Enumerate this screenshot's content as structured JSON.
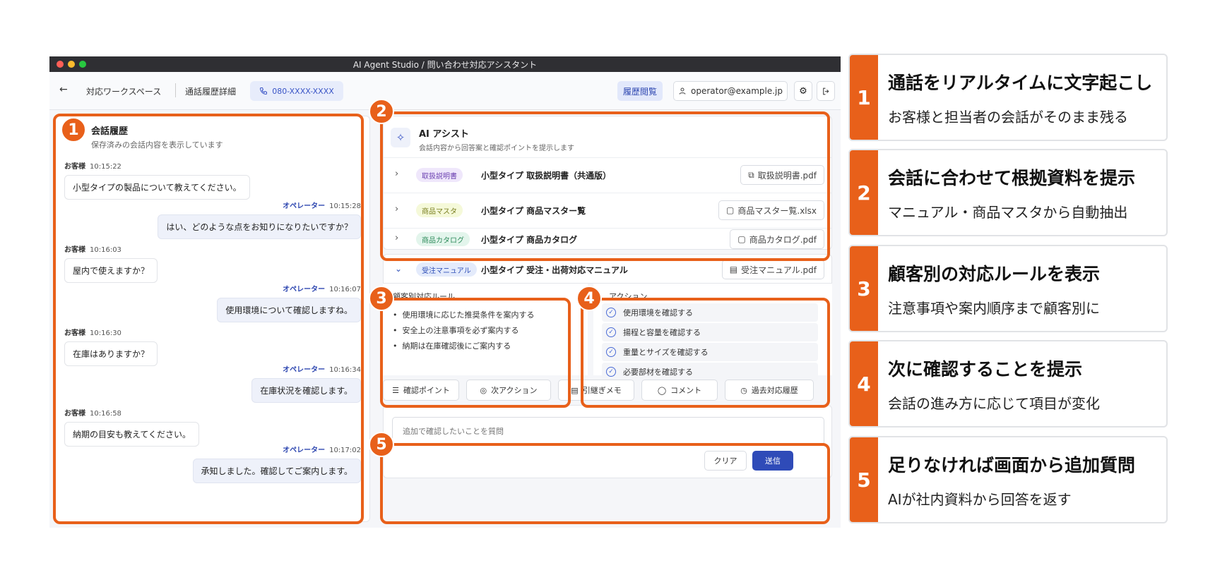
{
  "window": {
    "title": "AI Agent Studio / 問い合わせ対応アシスタント"
  },
  "header": {
    "back_icon": "←",
    "breadcrumb1": "対応ワークスペース",
    "breadcrumb2": "通話履歴詳細",
    "phone": "080-XXXX-XXXX",
    "history_button": "履歴閲覧",
    "user": "operator@example.jp"
  },
  "chat": {
    "title": "会話履歴",
    "subtitle": "保存済みの会話内容を表示しています",
    "messages": [
      {
        "who": "お客様",
        "time": "10:15:22",
        "text": "小型タイプの製品について教えてください。"
      },
      {
        "who": "オペレーター",
        "time": "10:15:28",
        "text": "はい、どのような点をお知りになりたいですか？"
      },
      {
        "who": "お客様",
        "time": "10:16:03",
        "text": "屋内で使えますか？"
      },
      {
        "who": "オペレーター",
        "time": "10:16:07",
        "text": "使用環境について確認しますね。"
      },
      {
        "who": "お客様",
        "time": "10:16:30",
        "text": "在庫はありますか？"
      },
      {
        "who": "オペレーター",
        "time": "10:16:34",
        "text": "在庫状況を確認します。"
      },
      {
        "who": "お客様",
        "time": "10:16:58",
        "text": "納期の目安も教えてください。"
      },
      {
        "who": "オペレーター",
        "time": "10:17:02",
        "text": "承知しました。確認してご案内します。"
      }
    ]
  },
  "assist": {
    "title": "AI アシスト",
    "subtitle": "会話内容から回答案と確認ポイントを提示します",
    "docs": [
      {
        "tag": "取扱説明書",
        "name": "小型タイプ 取扱説明書（共通版）",
        "file": "取扱説明書.pdf"
      },
      {
        "tag": "商品マスタ",
        "name": "小型タイプ 商品マスター覧",
        "file": "商品マスター覧.xlsx"
      },
      {
        "tag": "商品カタログ",
        "name": "小型タイプ 商品カタログ",
        "file": "商品カタログ.pdf"
      },
      {
        "tag": "受注マニュアル",
        "name": "小型タイプ 受注・出荷対応マニュアル",
        "file": "受注マニュアル.pdf"
      }
    ]
  },
  "rules": {
    "title": "顧客別対応ルール",
    "items": [
      "使用環境に応じた推奨条件を案内する",
      "安全上の注意事項を必ず案内する",
      "納期は在庫確認後にご案内する"
    ]
  },
  "actions": {
    "title": "アクション",
    "items": [
      "使用環境を確認する",
      "揚程と容量を確認する",
      "重量とサイズを確認する",
      "必要部材を確認する"
    ]
  },
  "tabs": [
    "確認ポイント",
    "次アクション",
    "引継ぎメモ",
    "コメント",
    "過去対応履歴"
  ],
  "ask": {
    "placeholder": "追加で確認したいことを質問",
    "clear": "クリア",
    "send": "送信"
  },
  "callouts": {
    "numbers": [
      "1",
      "2",
      "3",
      "4",
      "5"
    ],
    "color": "#e8601a"
  },
  "legend": [
    {
      "num": "1",
      "title": "通話をリアルタイムに文字起こし",
      "sub": "お客様と担当者の会話がそのまま残る"
    },
    {
      "num": "2",
      "title": "会話に合わせて根拠資料を提示",
      "sub": "マニュアル・商品マスタから自動抽出"
    },
    {
      "num": "3",
      "title": "顧客別の対応ルールを表示",
      "sub": "注意事項や案内順序まで顧客別に"
    },
    {
      "num": "4",
      "title": "次に確認することを提示",
      "sub": "会話の進み方に応じて項目が変化"
    },
    {
      "num": "5",
      "title": "足りなければ画面から追加質問",
      "sub": "AIが社内資料から回答を返す"
    }
  ]
}
